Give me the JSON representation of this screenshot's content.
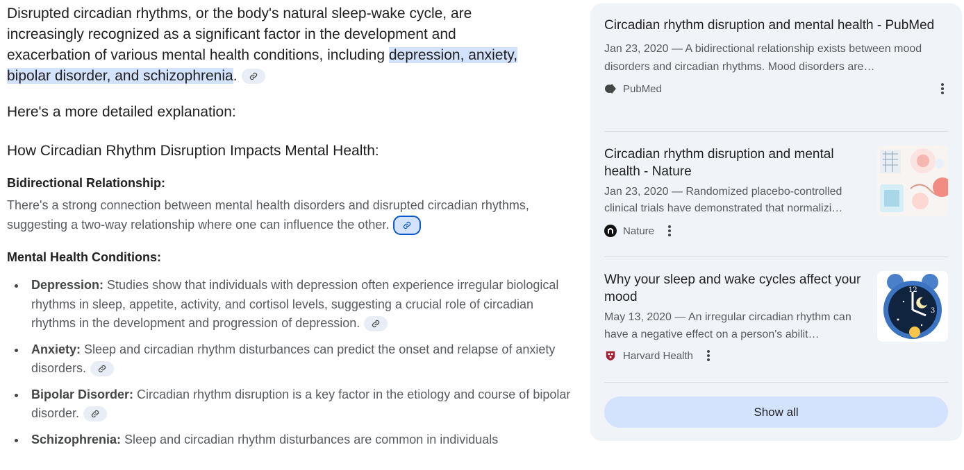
{
  "answer": {
    "intro_text": "Disrupted circadian rhythms, or the body's natural sleep-wake cycle, are increasingly recognized as a significant factor in the development and exacerbation of various mental health conditions, including ",
    "intro_highlight": "depression, anxiety, bipolar disorder, and schizophrenia",
    "intro_end": ".",
    "explanation_lead": "Here's a more detailed explanation:",
    "section_heading": "How Circadian Rhythm Disruption Impacts Mental Health:",
    "bidirectional": {
      "heading": "Bidirectional Relationship:",
      "text": "There's a strong connection between mental health disorders and disrupted circadian rhythms, suggesting a two-way relationship where one can influence the other."
    },
    "conditions_heading": "Mental Health Conditions:",
    "conditions": [
      {
        "term": "Depression:",
        "text": " Studies show that individuals with depression often experience irregular biological rhythms in sleep, appetite, activity, and cortisol levels, suggesting a crucial role of circadian rhythms in the development and progression of depression."
      },
      {
        "term": "Anxiety:",
        "text": " Sleep and circadian rhythm disturbances can predict the onset and relapse of anxiety disorders."
      },
      {
        "term": "Bipolar Disorder:",
        "text": " Circadian rhythm disruption is a key factor in the etiology and course of bipolar disorder."
      },
      {
        "term": "Schizophrenia:",
        "text": " Sleep and circadian rhythm disturbances are common in individuals"
      }
    ]
  },
  "sources": {
    "items": [
      {
        "title": "Circadian rhythm disruption and mental health - PubMed",
        "snippet": "Jan 23, 2020 — A bidirectional relationship exists between mood disorders and circadian rhythms. Mood disorders are…",
        "source": "PubMed",
        "icon": "pubmed-logo-icon"
      },
      {
        "title": "Circadian rhythm disruption and mental health - Nature",
        "snippet": "Jan 23, 2020 — Randomized placebo-controlled clinical trials have demonstrated that normalizi…",
        "source": "Nature",
        "icon": "nature-logo-icon"
      },
      {
        "title": "Why your sleep and wake cycles affect your mood",
        "snippet": "May 13, 2020 — An irregular circadian rhythm can have a negative effect on a person's abilit…",
        "source": "Harvard Health",
        "icon": "harvard-shield-icon"
      }
    ],
    "show_all_label": "Show all"
  },
  "colors": {
    "highlight": "#d3e3fd",
    "panel_bg": "#f0f4f9",
    "accent": "#0b57d0"
  }
}
